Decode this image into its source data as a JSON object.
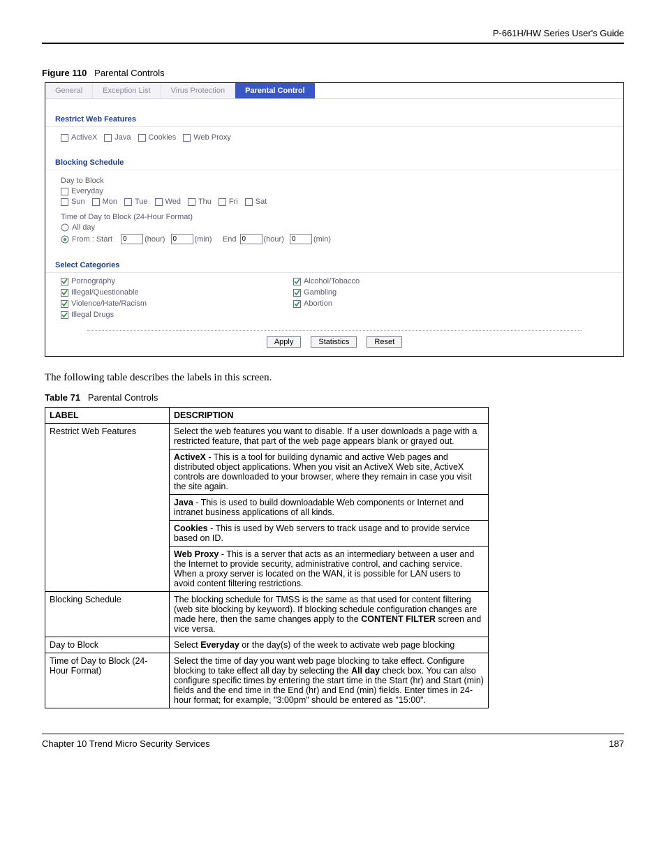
{
  "header_guide": "P-661H/HW Series User's Guide",
  "figure_number": "Figure 110",
  "figure_title": "Parental Controls",
  "tabs": {
    "general": "General",
    "exception": "Exception List",
    "virus": "Virus Protection",
    "parental": "Parental Control"
  },
  "sections": {
    "restrict_header": "Restrict Web Features",
    "restrict": {
      "activex": "ActiveX",
      "java": "Java",
      "cookies": "Cookies",
      "webproxy": "Web Proxy"
    },
    "blocking_header": "Blocking Schedule",
    "blocking": {
      "day_to_block": "Day to Block",
      "everyday": "Everyday",
      "sun": "Sun",
      "mon": "Mon",
      "tue": "Tue",
      "wed": "Wed",
      "thu": "Thu",
      "fri": "Fri",
      "sat": "Sat",
      "time_label": "Time of Day to Block  (24-Hour Format)",
      "all_day": "All day",
      "from_label": "From :  Start",
      "hour": "(hour)",
      "min": "(min)",
      "end_label": "End",
      "val_start_h": "0",
      "val_start_m": "0",
      "val_end_h": "0",
      "val_end_m": "0"
    },
    "categories_header": "Select Categories",
    "categories": {
      "porn": "Pornography",
      "illegal_q": "Illegal/Questionable",
      "violence": "Violence/Hate/Racism",
      "drugs": "Illegal Drugs",
      "alcohol": "Alcohol/Tobacco",
      "gambling": "Gambling",
      "abortion": "Abortion"
    },
    "buttons": {
      "apply": "Apply",
      "statistics": "Statistics",
      "reset": "Reset"
    }
  },
  "intro_text": "The following table describes the labels in this screen.",
  "table_number": "Table 71",
  "table_title": "Parental Controls",
  "table_headers": {
    "label": "LABEL",
    "desc": "DESCRIPTION"
  },
  "rows": {
    "r1_label": "Restrict Web Features",
    "r1_d1": "Select the web features you want to disable. If a user downloads a page with a restricted feature, that part of the web page appears blank or grayed out.",
    "r1_ax_b": "ActiveX",
    "r1_ax": " - This is a tool for building dynamic and active Web pages and distributed object applications. When you visit an ActiveX Web site, ActiveX controls are downloaded to your browser, where they remain in case you visit the site again.",
    "r1_jv_b": "Java",
    "r1_jv": " - This is used to build downloadable Web components or Internet and intranet business applications of all kinds.",
    "r1_ck_b": "Cookies",
    "r1_ck": " - This is used by Web servers to track usage and to provide service based on ID.",
    "r1_wp_b": "Web Proxy",
    "r1_wp": " - This is a server that acts as an intermediary between a user and the Internet to provide security, administrative control, and caching service. When a proxy server is located on the WAN, it is possible for LAN users to avoid content filtering restrictions.",
    "r2_label": "Blocking Schedule",
    "r2_d_pre": "The blocking schedule for TMSS is the same as that used for content filtering (web site blocking by keyword). If blocking schedule configuration changes are made here, then the same changes apply to the ",
    "r2_d_bold": "CONTENT FILTER",
    "r2_d_post": " screen and vice versa.",
    "r3_label": "Day to Block",
    "r3_d_pre": "Select ",
    "r3_d_bold": "Everyday",
    "r3_d_post": " or the day(s) of the week to activate web page blocking",
    "r4_label": "Time of Day to Block (24-Hour Format)",
    "r4_d_pre": "Select the time of day you want web page blocking to take effect. Configure blocking to take effect all day by selecting the ",
    "r4_d_bold": "All day",
    "r4_d_post": " check box. You can also configure specific times by entering the start time in the Start (hr) and Start (min) fields and the end time in the End (hr) and End (min) fields. Enter times in 24-hour format; for example, \"3:00pm\" should be entered as \"15:00\"."
  },
  "footer": {
    "chapter": "Chapter 10 Trend Micro Security Services",
    "page": "187"
  }
}
